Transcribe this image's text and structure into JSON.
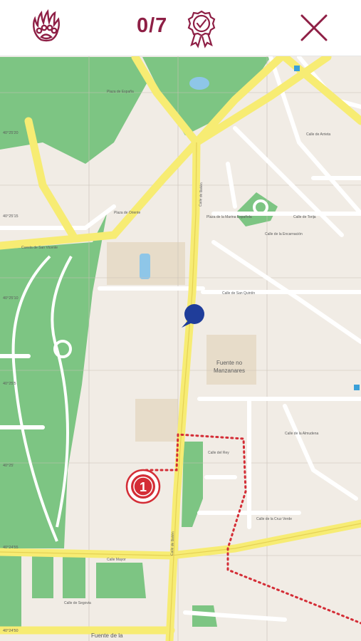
{
  "header": {
    "paw_icon": "paw-icon",
    "progress_text": "0/7",
    "badge_icon": "award-badge-icon",
    "close_icon": "close-icon"
  },
  "colors": {
    "brand": "#8e1f45",
    "park": "#7dc583",
    "major_road": "#f7ec73",
    "route": "#d42d36",
    "location": "#1f3d9a"
  },
  "map": {
    "district_label_line1": "Fuente no",
    "district_label_line2": "Manzanares",
    "bottom_label": "Fuente de la",
    "street_labels": [
      "Plaza de España",
      "Calle de Bailén",
      "Cuesta de San Vicente",
      "Calle de San Quintín",
      "Calle de la Encarnación",
      "Plaza de la Marina Española",
      "Calle de Torija",
      "Calle de Bailén",
      "Calle del Rey",
      "Calle Mayor",
      "Calle de Segovia",
      "Calle de la Almudena",
      "Calle de la Cruz Verde",
      "Plaza de Oriente",
      "Calle de Arrieta"
    ],
    "marker_number": "1",
    "coordinate_labels": [
      "40°25'20",
      "40°25'15",
      "40°25'10",
      "40°25'5",
      "40°25'",
      "40°24'55",
      "40°24'50"
    ]
  }
}
